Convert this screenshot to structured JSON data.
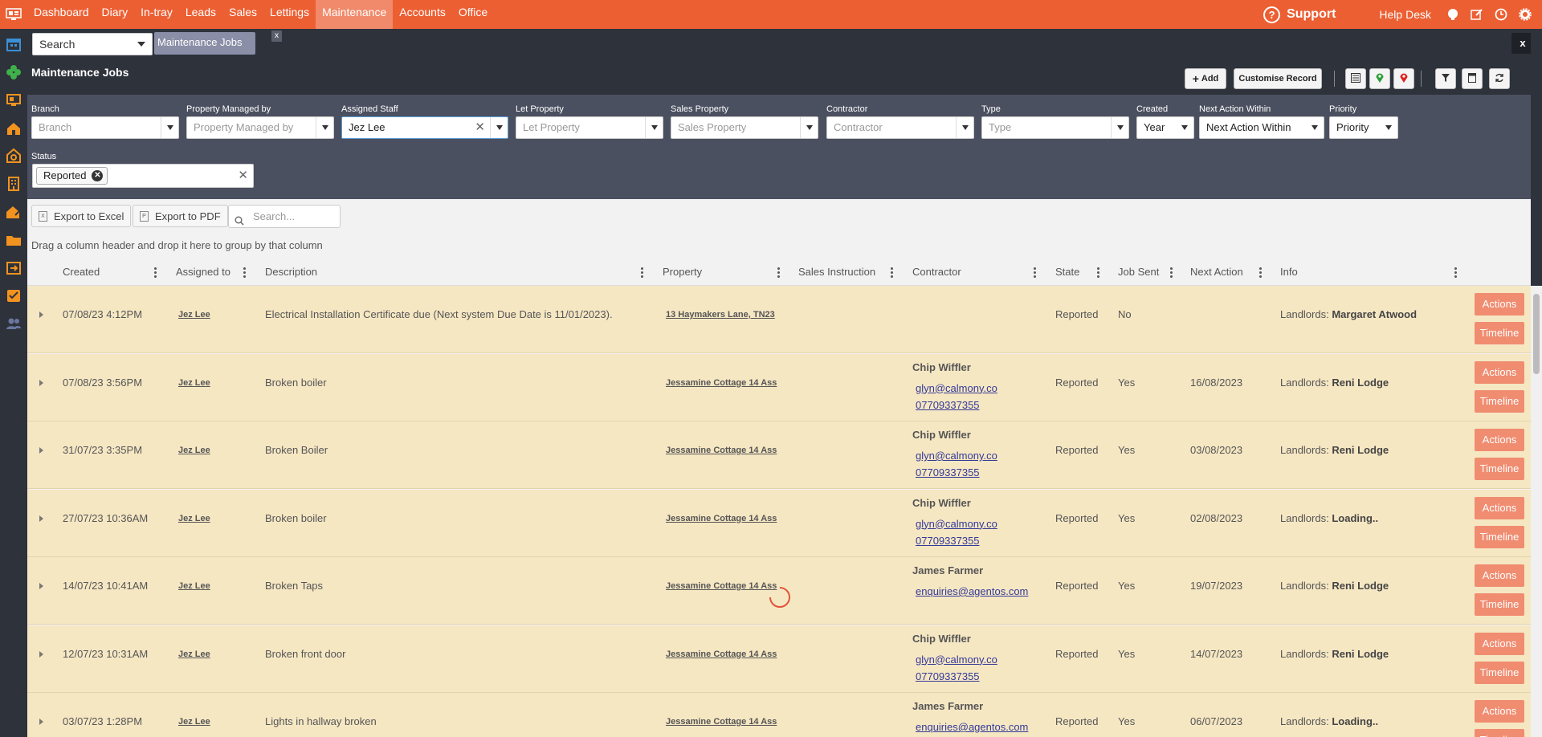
{
  "nav": {
    "items": [
      "Dashboard",
      "Diary",
      "In-tray",
      "Leads",
      "Sales",
      "Lettings",
      "Maintenance",
      "Accounts",
      "Office"
    ],
    "active_index": 6,
    "support_label": "Support",
    "helpdesk_label": "Help Desk"
  },
  "header": {
    "search_label": "Search",
    "tab_label": "Maintenance Jobs",
    "tab_close": "x",
    "close_all": "x",
    "page_title": "Maintenance Jobs",
    "add_label": "Add",
    "customise_label": "Customise Record"
  },
  "filters": {
    "branch": {
      "label": "Branch",
      "placeholder": "Branch"
    },
    "managed_by": {
      "label": "Property Managed by",
      "placeholder": "Property Managed by"
    },
    "assigned_staff": {
      "label": "Assigned Staff",
      "value": "Jez Lee"
    },
    "let_property": {
      "label": "Let Property",
      "placeholder": "Let Property"
    },
    "sales_property": {
      "label": "Sales Property",
      "placeholder": "Sales Property"
    },
    "contractor": {
      "label": "Contractor",
      "placeholder": "Contractor"
    },
    "type": {
      "label": "Type",
      "placeholder": "Type"
    },
    "created": {
      "label": "Created",
      "value": "Year"
    },
    "next_action": {
      "label": "Next Action Within",
      "value": "Next Action Within"
    },
    "priority": {
      "label": "Priority",
      "value": "Priority"
    },
    "status": {
      "label": "Status",
      "chip": "Reported"
    }
  },
  "grid_toolbar": {
    "export_excel": "Export to Excel",
    "export_pdf": "Export to PDF",
    "search_placeholder": "Search...",
    "group_hint": "Drag a column header and drop it here to group by that column"
  },
  "columns": [
    "Created",
    "Assigned to",
    "Description",
    "Property",
    "Sales Instruction",
    "Contractor",
    "State",
    "Job Sent",
    "Next Action",
    "Info"
  ],
  "row_buttons": {
    "actions": "Actions",
    "timeline": "Timeline"
  },
  "info_prefix": "Landlords:",
  "rows": [
    {
      "created": "07/08/23 4:12PM",
      "assigned": "Jez Lee",
      "description": "Electrical Installation Certificate due (Next system Due Date is 11/01/2023).",
      "property": "13 Haymakers Lane, TN23",
      "contractor": "",
      "email": "",
      "phone": "",
      "state": "Reported",
      "job_sent": "No",
      "next_action": "",
      "landlord": "Margaret Atwood"
    },
    {
      "created": "07/08/23 3:56PM",
      "assigned": "Jez Lee",
      "description": "Broken boiler",
      "property": "Jessamine Cottage 14 Ass",
      "contractor": "Chip Wiffler",
      "email": "glyn@calmony.co",
      "phone": "07709337355",
      "state": "Reported",
      "job_sent": "Yes",
      "next_action": "16/08/2023",
      "landlord": "Reni Lodge"
    },
    {
      "created": "31/07/23 3:35PM",
      "assigned": "Jez Lee",
      "description": "Broken Boiler",
      "property": "Jessamine Cottage 14 Ass",
      "contractor": "Chip Wiffler",
      "email": "glyn@calmony.co",
      "phone": "07709337355",
      "state": "Reported",
      "job_sent": "Yes",
      "next_action": "03/08/2023",
      "landlord": "Reni Lodge"
    },
    {
      "created": "27/07/23 10:36AM",
      "assigned": "Jez Lee",
      "description": "Broken boiler",
      "property": "Jessamine Cottage 14 Ass",
      "contractor": "Chip Wiffler",
      "email": "glyn@calmony.co",
      "phone": "07709337355",
      "state": "Reported",
      "job_sent": "Yes",
      "next_action": "02/08/2023",
      "landlord": "Loading.."
    },
    {
      "created": "14/07/23 10:41AM",
      "assigned": "Jez Lee",
      "description": "Broken Taps",
      "property": "Jessamine Cottage 14 Ass",
      "contractor": "James Farmer",
      "email": "enquiries@agentos.com",
      "phone": "",
      "state": "Reported",
      "job_sent": "Yes",
      "next_action": "19/07/2023",
      "landlord": "Reni Lodge"
    },
    {
      "created": "12/07/23 10:31AM",
      "assigned": "Jez Lee",
      "description": "Broken front door",
      "property": "Jessamine Cottage 14 Ass",
      "contractor": "Chip Wiffler",
      "email": "glyn@calmony.co",
      "phone": "07709337355",
      "state": "Reported",
      "job_sent": "Yes",
      "next_action": "14/07/2023",
      "landlord": "Reni Lodge"
    },
    {
      "created": "03/07/23 1:28PM",
      "assigned": "Jez Lee",
      "description": "Lights in hallway broken",
      "property": "Jessamine Cottage 14 Ass",
      "contractor": "James Farmer",
      "email": "enquiries@agentos.com",
      "phone": "",
      "state": "Reported",
      "job_sent": "Yes",
      "next_action": "06/07/2023",
      "landlord": "Loading.."
    }
  ]
}
